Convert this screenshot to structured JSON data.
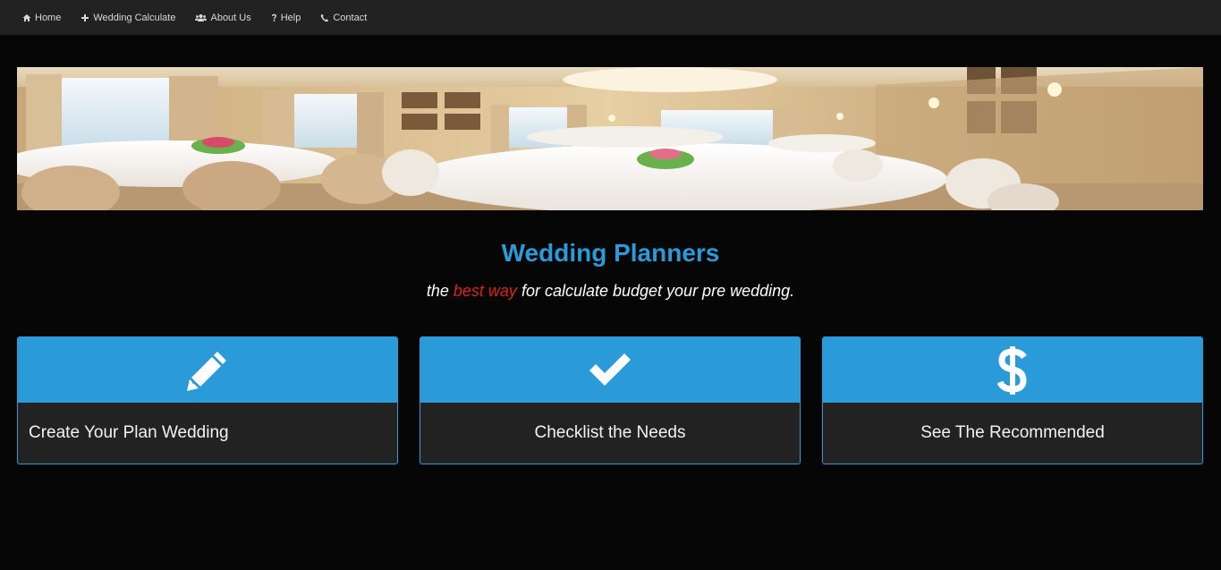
{
  "nav": {
    "items": [
      {
        "label": "Home",
        "icon": "home-icon"
      },
      {
        "label": "Wedding Calculate",
        "icon": "plus-icon"
      },
      {
        "label": "About Us",
        "icon": "users-icon"
      },
      {
        "label": "Help",
        "icon": "question-icon"
      },
      {
        "label": "Contact",
        "icon": "phone-icon"
      }
    ]
  },
  "hero": {
    "title": "Wedding Planners",
    "tagline_before": "the ",
    "tagline_highlight": "best way",
    "tagline_after": " for calculate budget your pre wedding."
  },
  "cards": [
    {
      "label": "Create Your Plan Wedding",
      "icon": "pencil-icon"
    },
    {
      "label": "Checklist the Needs",
      "icon": "check-icon"
    },
    {
      "label": "See The Recommended",
      "icon": "dollar-icon"
    }
  ],
  "colors": {
    "accent": "#2a9ad8",
    "highlight": "#d9261c",
    "navbar": "#222222",
    "background": "#060606",
    "card_body": "#222222"
  }
}
